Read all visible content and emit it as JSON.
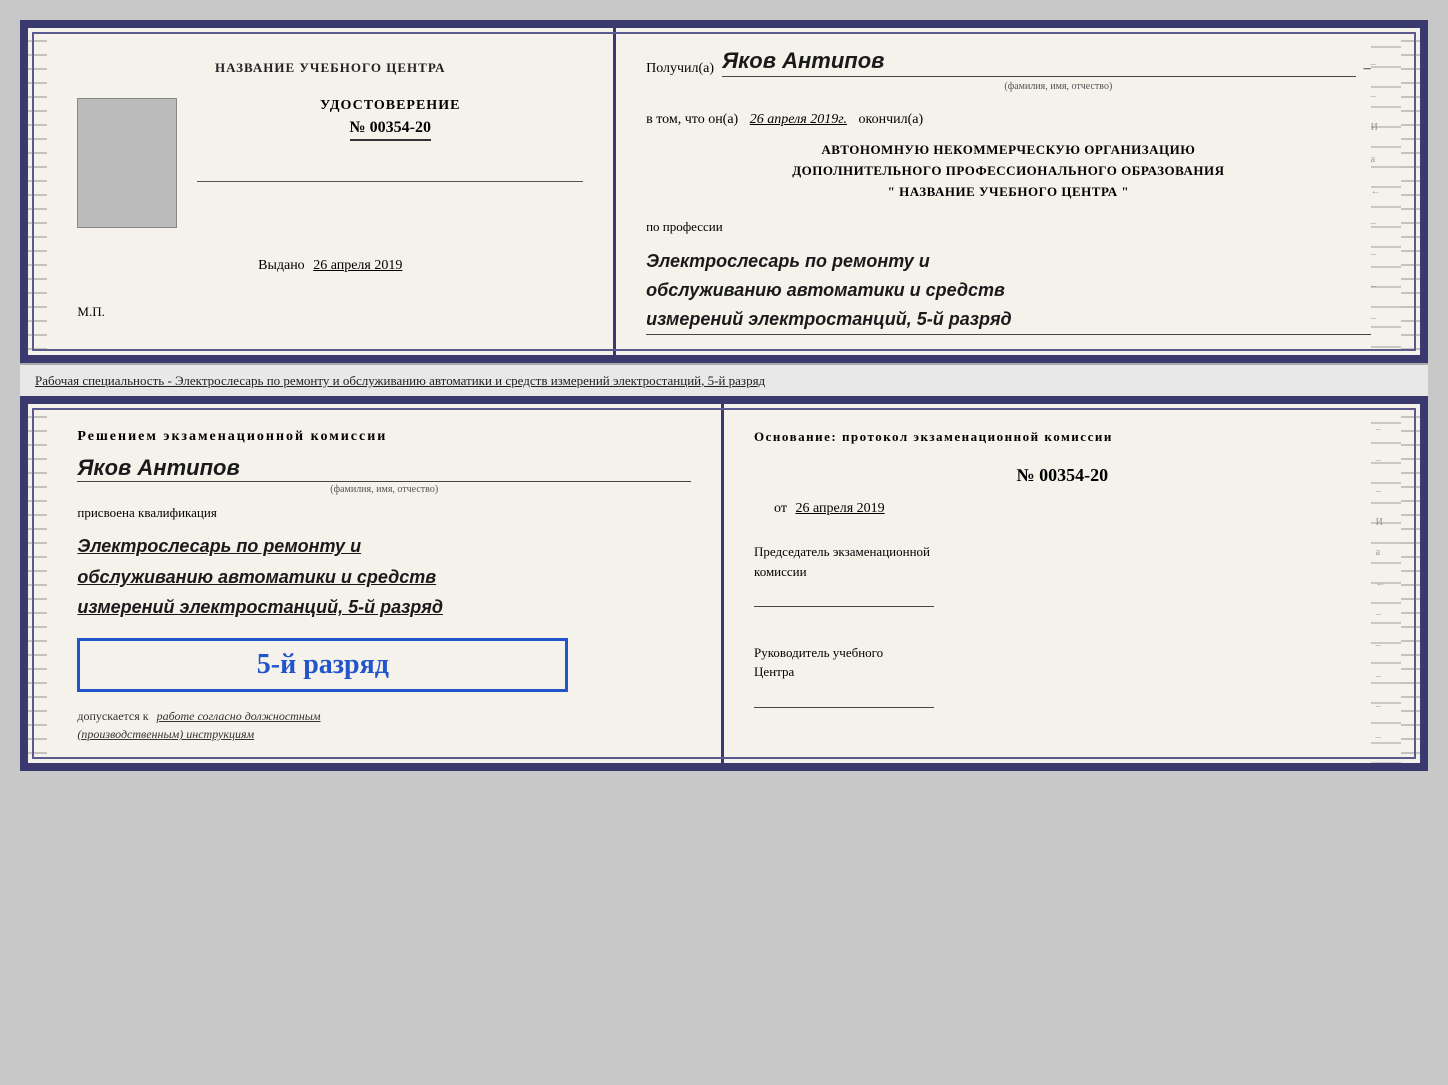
{
  "top_doc": {
    "left": {
      "heading": "НАЗВАНИЕ УЧЕБНОГО ЦЕНТРА",
      "cert_label": "УДОСТОВЕРЕНИЕ",
      "cert_number": "№ 00354-20",
      "issued_label": "Выдано",
      "issued_date": "26 апреля 2019",
      "mp": "М.П."
    },
    "right": {
      "received_label": "Получил(а)",
      "recipient_name": "Яков Антипов",
      "fio_caption": "(фамилия, имя, отчество)",
      "in_that_label": "в том, что он(а)",
      "date_value": "26 апреля 2019г.",
      "finished_label": "окончил(а)",
      "org_line1": "АВТОНОМНУЮ НЕКОММЕРЧЕСКУЮ ОРГАНИЗАЦИЮ",
      "org_line2": "ДОПОЛНИТЕЛЬНОГО ПРОФЕССИОНАЛЬНОГО ОБРАЗОВАНИЯ",
      "org_line3": "\"  НАЗВАНИЕ УЧЕБНОГО ЦЕНТРА  \"",
      "profession_label": "по профессии",
      "profession_line1": "Электрослесарь по ремонту и",
      "profession_line2": "обслуживанию автоматики и средств",
      "profession_line3": "измерений электростанций, 5-й разряд"
    }
  },
  "middle": {
    "text": "Рабочая специальность - Электрослесарь по ремонту и обслуживанию автоматики и средств измерений электростанций, 5-й разряд"
  },
  "bottom_doc": {
    "left": {
      "decision_heading": "Решением  экзаменационной  комиссии",
      "person_name": "Яков Антипов",
      "fio_caption": "(фамилия, имя, отчество)",
      "qualification_label": "присвоена квалификация",
      "profession_line1": "Электрослесарь по ремонту и",
      "profession_line2": "обслуживанию автоматики и средств",
      "profession_line3": "измерений электростанций, 5-й разряд",
      "rank_text": "5-й разряд",
      "allowed_label": "допускается к",
      "allowed_value": "работе согласно должностным",
      "allowed_value2": "(производственным) инструкциям"
    },
    "right": {
      "foundation_label": "Основание: протокол экзаменационной  комиссии",
      "cert_number": "№  00354-20",
      "from_label": "от",
      "from_date": "26 апреля 2019",
      "chairman_label": "Председатель экзаменационной",
      "chairman_label2": "комиссии",
      "director_label": "Руководитель учебного",
      "director_label2": "Центра"
    }
  }
}
